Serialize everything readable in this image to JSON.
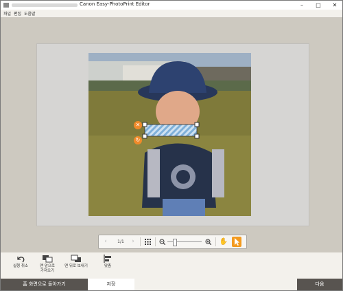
{
  "window": {
    "title": "Canon Easy-PhotoPrint Editor",
    "minimize": "–",
    "maximize": "□",
    "close": "✕"
  },
  "menu": {
    "items": [
      "파일",
      "편집",
      "도움말"
    ]
  },
  "zoombar": {
    "page_indicator": "1/1"
  },
  "tools": [
    {
      "label": "실행 취소",
      "icon": "undo-icon"
    },
    {
      "label": "맨 앞으로\n가져오기",
      "icon": "bring-to-front-icon"
    },
    {
      "label": "맨 뒤로 보내기",
      "icon": "send-to-back-icon"
    },
    {
      "label": "맞춤",
      "icon": "align-icon"
    }
  ],
  "footer": {
    "home": "홈 화면으로 돌아가기",
    "save": "저장",
    "next": "다음"
  },
  "colors": {
    "accent": "#f39a1f",
    "dark_button": "#585450",
    "canvas_bg": "#cdc9c0"
  }
}
